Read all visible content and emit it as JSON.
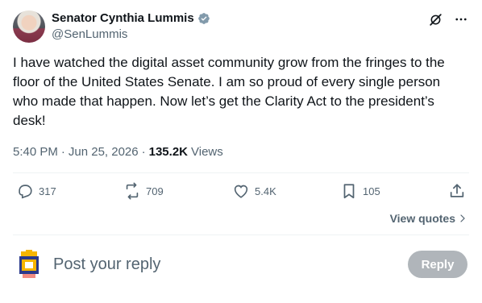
{
  "author": {
    "display_name": "Senator Cynthia Lummis",
    "handle": "@SenLummis",
    "verified": true
  },
  "icons": {
    "verified": "verified-badge-icon",
    "grok": "grok-icon",
    "more": "more-icon",
    "reply": "reply-icon",
    "retweet": "retweet-icon",
    "like": "heart-icon",
    "bookmark": "bookmark-icon",
    "share": "share-icon"
  },
  "tweet": {
    "text": "I have watched the digital asset community grow from the fringes to the floor of the United States Senate. I am so proud of every single person who made that happen. Now let’s get the Clarity Act to the president’s desk!",
    "time": "5:40 PM",
    "date": "Jun 25, 2026",
    "separator": "·",
    "views_count": "135.2K",
    "views_label": "Views"
  },
  "stats": {
    "replies": "317",
    "retweets": "709",
    "likes": "5.4K",
    "bookmarks": "105"
  },
  "view_quotes_label": "View quotes",
  "reply_box": {
    "placeholder": "Post your reply",
    "button_label": "Reply"
  },
  "colors": {
    "verified": "#829aab",
    "text": "#0f1419",
    "muted": "#536471",
    "divider": "#eff3f4"
  }
}
